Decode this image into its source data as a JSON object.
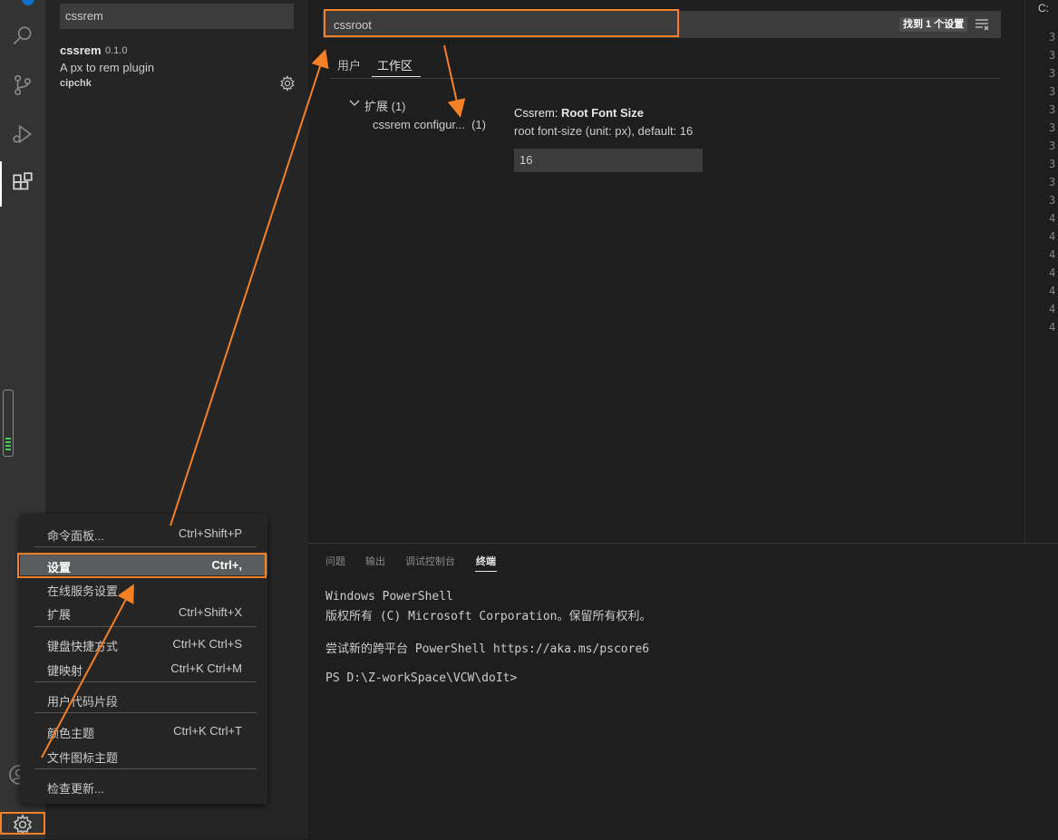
{
  "extension": {
    "search_value": "cssrem",
    "name": "cssrem",
    "version": "0.1.0",
    "description": "A px to rem plugin",
    "publisher": "cipchk"
  },
  "settings": {
    "search_value": "cssroot",
    "found_badge": "找到 1 个设置",
    "tabs": [
      "用户",
      "工作区"
    ],
    "toc_group": "扩展 (1)",
    "toc_item": "cssrem configur...  (1)",
    "setting_prefix": "Cssrem: ",
    "setting_name": "Root Font Size",
    "setting_description": "root font-size (unit: px), default: 16",
    "setting_value": "16"
  },
  "right_panel": {
    "label": "C:",
    "line_numbers": [
      "3",
      "3",
      "3",
      "3",
      "3",
      "3",
      "3",
      "3",
      "3",
      "3",
      "4",
      "4",
      "4",
      "4",
      "4",
      "4",
      "4"
    ]
  },
  "panel": {
    "tabs": [
      "问题",
      "输出",
      "调试控制台",
      "终端"
    ],
    "terminal_lines": [
      "Windows PowerShell",
      "版权所有 (C) Microsoft Corporation。保留所有权利。",
      "",
      "尝试新的跨平台 PowerShell https://aka.ms/pscore6",
      "",
      "PS D:\\Z-workSpace\\VCW\\doIt>"
    ]
  },
  "menu": {
    "items": [
      {
        "label": "命令面板...",
        "shortcut": "Ctrl+Shift+P"
      },
      {
        "label": "设置",
        "shortcut": "Ctrl+,"
      },
      {
        "label": "在线服务设置",
        "shortcut": ""
      },
      {
        "label": "扩展",
        "shortcut": "Ctrl+Shift+X"
      },
      {
        "label": "键盘快捷方式",
        "shortcut": "Ctrl+K Ctrl+S"
      },
      {
        "label": "键映射",
        "shortcut": "Ctrl+K Ctrl+M"
      },
      {
        "label": "用户代码片段",
        "shortcut": ""
      },
      {
        "label": "颜色主题",
        "shortcut": "Ctrl+K Ctrl+T"
      },
      {
        "label": "文件图标主题",
        "shortcut": ""
      },
      {
        "label": "检查更新...",
        "shortcut": ""
      }
    ]
  },
  "colors": {
    "annotation": "#f58025",
    "accent_blue": "#0e6fc7"
  }
}
